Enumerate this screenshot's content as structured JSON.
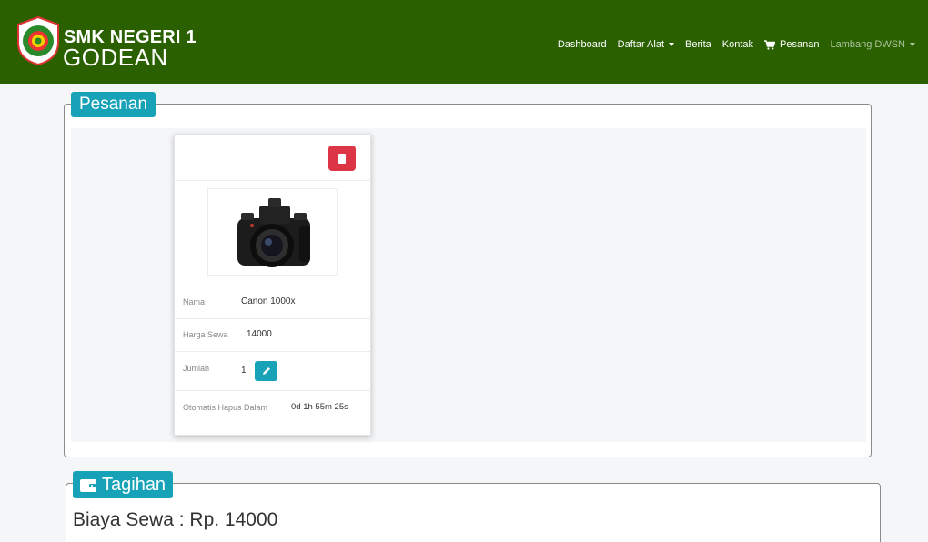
{
  "brand": {
    "line1": "SMK NEGERI 1",
    "line2": "GODEAN"
  },
  "nav": {
    "items": [
      {
        "label": "Dashboard"
      },
      {
        "label": "Daftar Alat"
      },
      {
        "label": "Berita"
      },
      {
        "label": "Kontak"
      },
      {
        "label": "Pesanan"
      }
    ],
    "user": "Lambang DWSN"
  },
  "pesanan": {
    "legend": "Pesanan",
    "card": {
      "image_icon": "camera-photo",
      "fields": {
        "nama_label": "Nama",
        "nama_value": "Canon 1000x",
        "harga_label": "Harga Sewa",
        "harga_value": "14000",
        "jumlah_label": "Jumlah",
        "jumlah_value": "1",
        "hapus_label": "Otomatis Hapus Dalam",
        "hapus_value": "0d 1h 55m 25s"
      }
    }
  },
  "tagihan": {
    "legend": "Tagihan",
    "biaya_text": "Biaya Sewa : Rp. 14000"
  },
  "colors": {
    "navbar": "#2a6000",
    "info": "#17a2b8",
    "danger": "#dc3545",
    "content_bg": "#f4f6f8"
  }
}
